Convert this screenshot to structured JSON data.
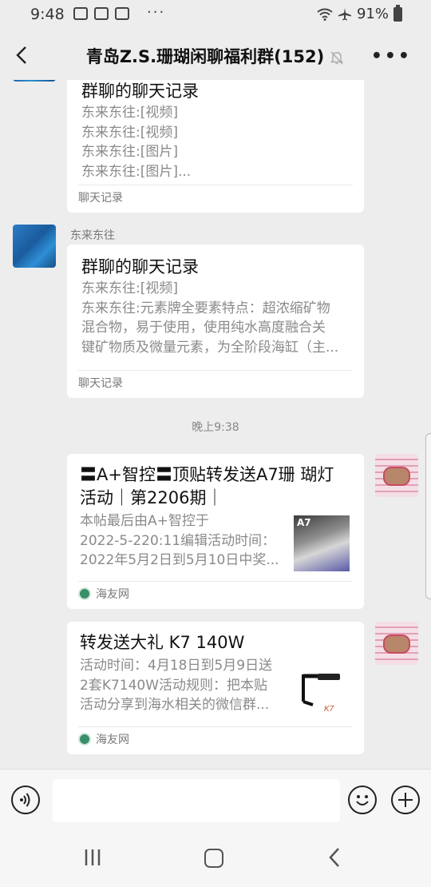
{
  "status": {
    "time": "9:48",
    "dots": "···",
    "battery": "91%"
  },
  "header": {
    "title": "青岛Z.S.珊瑚闲聊福利群(152)"
  },
  "messages": [
    {
      "card_title": "群聊的聊天记录",
      "lines": [
        "东来东往:[视频]",
        "东来东往:[视频]",
        "东来东往:[图片]",
        "东来东往:[图片]..."
      ],
      "footer": "聊天记录"
    },
    {
      "sender": "东来东往",
      "card_title": "群聊的聊天记录",
      "lines": [
        "东来东往:[视频]",
        "东来东往:元素牌全要素特点：超浓缩矿物",
        "混合物，易于使用，使用纯水高度融合关",
        "键矿物质及微量元素，为全阶段海缸（主..."
      ],
      "footer": "聊天记录"
    }
  ],
  "timestamp": "晚上9:38",
  "shares": [
    {
      "title_lines": [
        "〓A+智控〓顶贴转发送A7珊 瑚灯",
        "活动｜第2206期｜"
      ],
      "lines": [
        "本帖最后由A+智控于",
        "2022-5-220:11编辑活动时间：",
        "2022年5月2日到5月10日中奖..."
      ],
      "thumb_label": "A7",
      "source": "海友网"
    },
    {
      "title_lines": [
        "转发送大礼 K7 140W"
      ],
      "lines": [
        "活动时间：4月18日到5月9日送",
        "2套K7140W活动规则：把本贴",
        "活动分享到海水相关的微信群..."
      ],
      "source": "海友网"
    }
  ],
  "colors": {
    "background": "#ededed",
    "card": "#ffffff",
    "source_icon": "#3a8f6b"
  }
}
